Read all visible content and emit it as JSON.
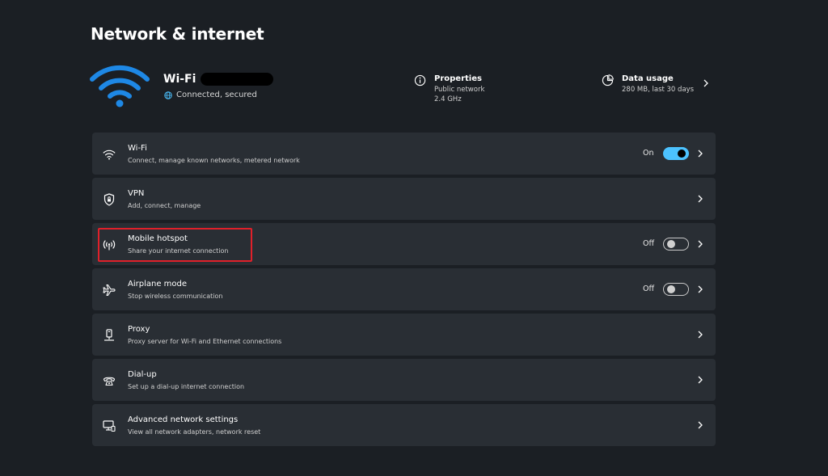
{
  "page": {
    "title": "Network & internet"
  },
  "header": {
    "wifi_name": "Wi-Fi",
    "connection_status": "Connected, secured",
    "properties": {
      "title": "Properties",
      "line1": "Public network",
      "line2": "2.4 GHz",
      "icon": "info-icon"
    },
    "data_usage": {
      "title": "Data usage",
      "line1": "280 MB, last 30 days",
      "icon": "data-usage-icon"
    }
  },
  "rows": [
    {
      "title": "Wi-Fi",
      "desc": "Connect, manage known networks, metered network",
      "icon": "wifi-icon",
      "state": "On",
      "toggle": true
    },
    {
      "title": "VPN",
      "desc": "Add, connect, manage",
      "icon": "vpn-shield-icon"
    },
    {
      "title": "Mobile hotspot",
      "desc": "Share your internet connection",
      "icon": "hotspot-icon",
      "state": "Off",
      "toggle": false
    },
    {
      "title": "Airplane mode",
      "desc": "Stop wireless communication",
      "icon": "airplane-icon",
      "state": "Off",
      "toggle": false
    },
    {
      "title": "Proxy",
      "desc": "Proxy server for Wi-Fi and Ethernet connections",
      "icon": "proxy-icon"
    },
    {
      "title": "Dial-up",
      "desc": "Set up a dial-up internet connection",
      "icon": "dial-up-icon"
    },
    {
      "title": "Advanced network settings",
      "desc": "View all network adapters, network reset",
      "icon": "advanced-network-icon"
    }
  ],
  "colors": {
    "background": "#1b1f24",
    "card": "#292e34",
    "accent": "#4cc2ff",
    "wifi_hero": "#1e88e5",
    "highlight": "#e0202a"
  }
}
